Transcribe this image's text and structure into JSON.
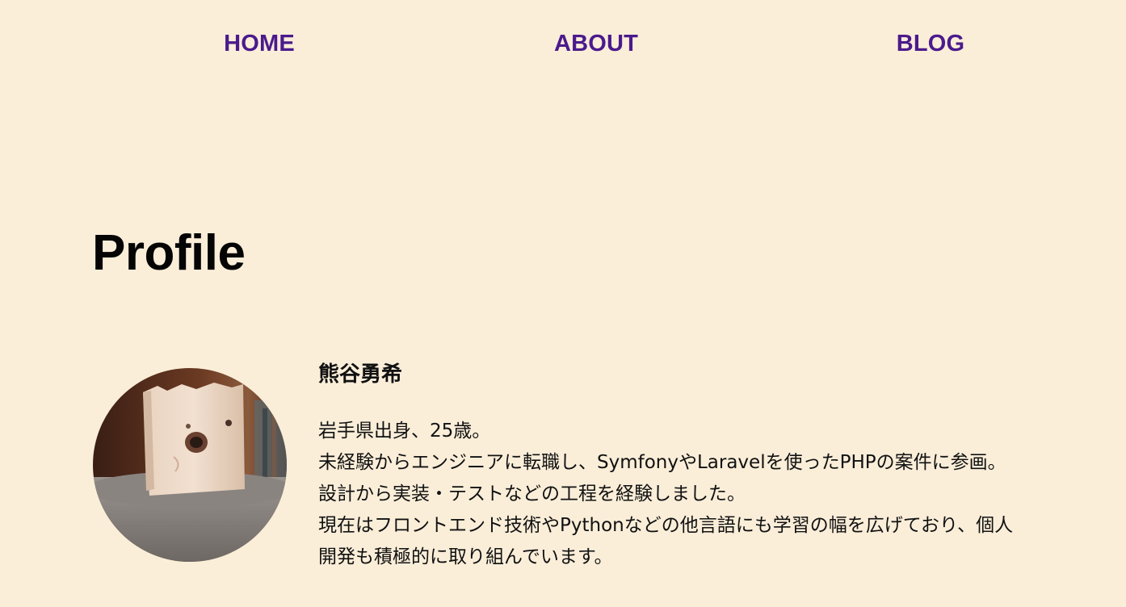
{
  "nav": {
    "items": [
      {
        "label": "HOME"
      },
      {
        "label": "ABOUT"
      },
      {
        "label": "BLOG"
      }
    ],
    "color": "#4B1A8C"
  },
  "page": {
    "title": "Profile",
    "background": "#FAEED9"
  },
  "profile": {
    "name": "熊谷勇希",
    "avatar_icon": "profile-photo",
    "bio_lines": [
      "岩手県出身、25歳。",
      "未経験からエンジニアに転職し、SymfonyやLaravelを使ったPHPの案件に参画。",
      "設計から実装・テストなどの工程を経験しました。",
      "現在はフロントエンド技術やPythonなどの他言語にも学習の幅を広げており、個人",
      "開発も積極的に取り組んでいます。"
    ]
  }
}
